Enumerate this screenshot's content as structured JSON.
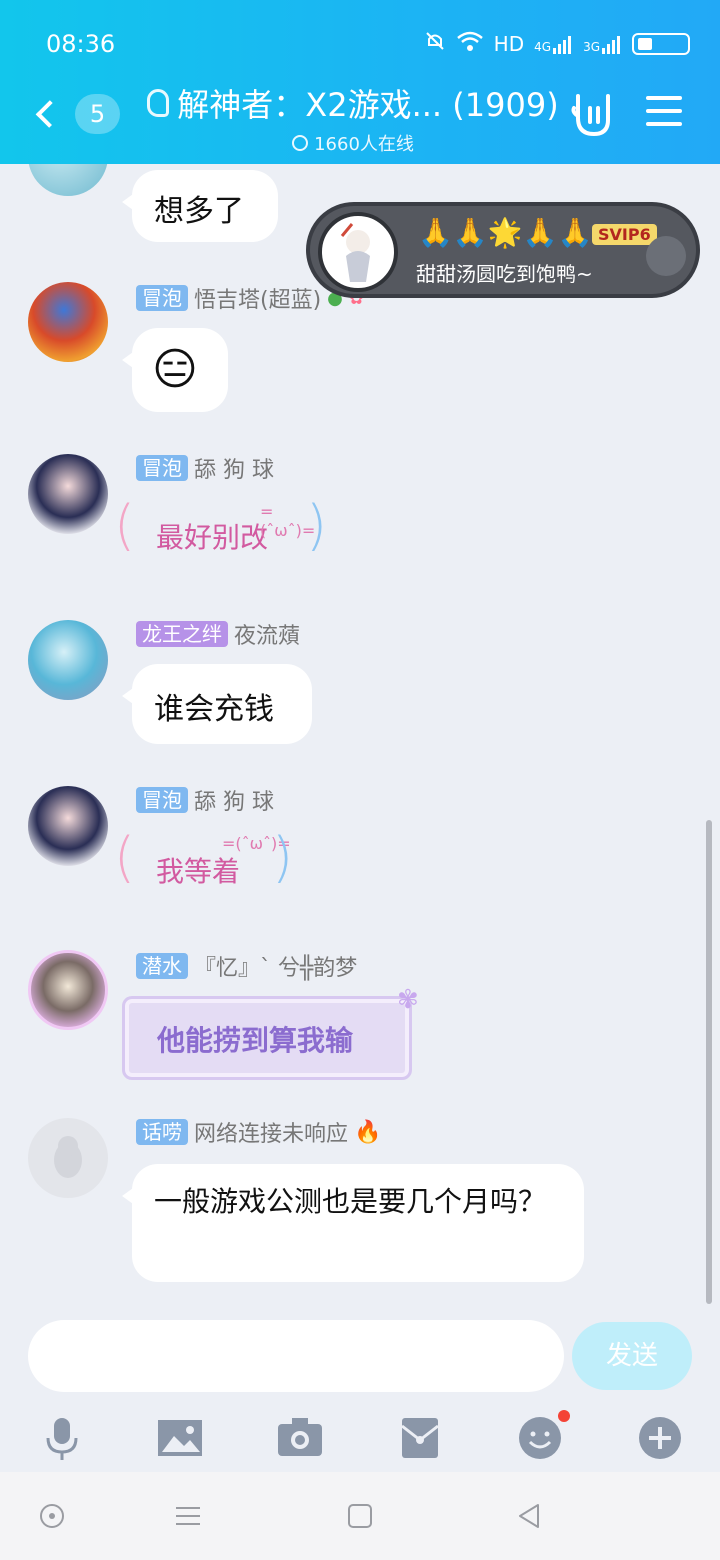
{
  "status_bar": {
    "time": "08:36",
    "network_label": "HD",
    "signal_1": "4G",
    "signal_2": "3G"
  },
  "header": {
    "unread_count": "5",
    "title": "解神者：X2游戏... (1909)",
    "online": "1660人在线"
  },
  "overlay_card": {
    "emojis": "🙏🙏🌟🙏🙏",
    "vip_tag": "SVIP6",
    "text": "甜甜汤圆吃到饱鸭~"
  },
  "messages": [
    {
      "text": "想多了"
    },
    {
      "badge": "冒泡",
      "name": "悟吉塔(超蓝)",
      "emoji": "😑"
    },
    {
      "badge": "冒泡",
      "name": "舔 狗 球",
      "text": "最好别改"
    },
    {
      "badge": "龙王之绊",
      "name": "夜流薠",
      "text": "谁会充钱"
    },
    {
      "badge": "冒泡",
      "name": "舔 狗 球",
      "text": "我等着"
    },
    {
      "badge": "潜水",
      "name": "『忆』ˋ 兮╬韵梦",
      "text": "他能捞到算我输"
    },
    {
      "badge": "话唠",
      "name": "网络连接未响应",
      "text": "一般游戏公测也是要几个月吗？"
    }
  ],
  "input": {
    "placeholder": "",
    "send_label": "发送"
  },
  "colors": {
    "header_start": "#12c6ec",
    "header_end": "#22a9f6",
    "badge_blue": "#7fb8f0",
    "badge_purple": "#b692e8",
    "send_bg": "#bfeefa"
  }
}
